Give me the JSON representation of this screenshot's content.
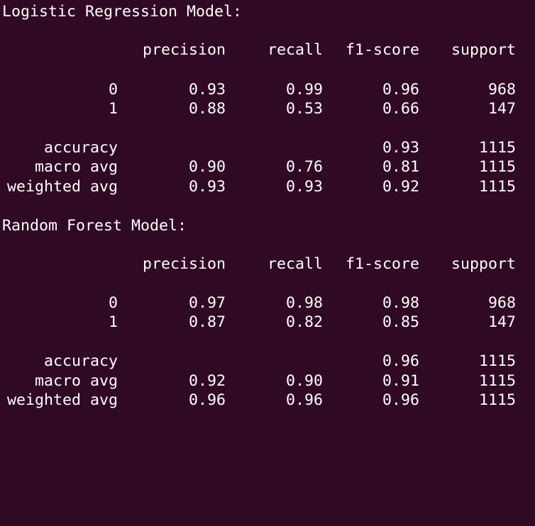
{
  "reports": [
    {
      "title": "Logistic Regression Model:",
      "headers": [
        "",
        "precision",
        "recall",
        "f1-score",
        "support"
      ],
      "rows": [
        [
          "0",
          "0.93",
          "0.99",
          "0.96",
          "968"
        ],
        [
          "1",
          "0.88",
          "0.53",
          "0.66",
          "147"
        ]
      ],
      "summary": [
        [
          "accuracy",
          "",
          "",
          "0.93",
          "1115"
        ],
        [
          "macro avg",
          "0.90",
          "0.76",
          "0.81",
          "1115"
        ],
        [
          "weighted avg",
          "0.93",
          "0.93",
          "0.92",
          "1115"
        ]
      ]
    },
    {
      "title": "Random Forest Model:",
      "headers": [
        "",
        "precision",
        "recall",
        "f1-score",
        "support"
      ],
      "rows": [
        [
          "0",
          "0.97",
          "0.98",
          "0.98",
          "968"
        ],
        [
          "1",
          "0.87",
          "0.82",
          "0.85",
          "147"
        ]
      ],
      "summary": [
        [
          "accuracy",
          "",
          "",
          "0.96",
          "1115"
        ],
        [
          "macro avg",
          "0.92",
          "0.90",
          "0.91",
          "1115"
        ],
        [
          "weighted avg",
          "0.96",
          "0.96",
          "0.96",
          "1115"
        ]
      ]
    }
  ]
}
